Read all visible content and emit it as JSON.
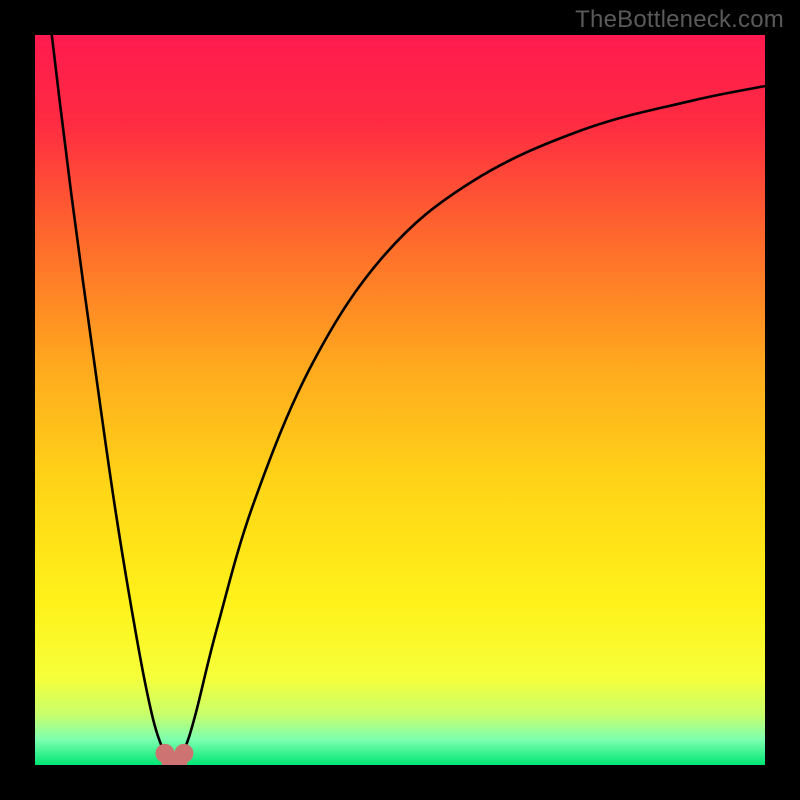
{
  "watermark": "TheBottleneck.com",
  "colors": {
    "frame": "#000000",
    "curve": "#000000",
    "marker": "#cd7472",
    "gradient_stops": [
      {
        "offset": 0.0,
        "color": "#ff1a4f"
      },
      {
        "offset": 0.12,
        "color": "#ff2b42"
      },
      {
        "offset": 0.28,
        "color": "#ff6a2c"
      },
      {
        "offset": 0.45,
        "color": "#ffa81e"
      },
      {
        "offset": 0.62,
        "color": "#ffd617"
      },
      {
        "offset": 0.78,
        "color": "#fff21a"
      },
      {
        "offset": 0.88,
        "color": "#f6ff3a"
      },
      {
        "offset": 0.93,
        "color": "#c9ff6a"
      },
      {
        "offset": 0.965,
        "color": "#7dffb0"
      },
      {
        "offset": 1.0,
        "color": "#00e673"
      }
    ]
  },
  "chart_data": {
    "type": "line",
    "title": "",
    "xlabel": "",
    "ylabel": "",
    "xlim": [
      0,
      100
    ],
    "ylim": [
      0,
      100
    ],
    "notes": "Single V-shaped bottleneck curve. x shown as position across plot width in %, y shown in % of plot height (0 = bottom/green, 100 = top/red). Minimum (optimal/no-bottleneck) near x≈19. Highlighted marker points along the floor of the V.",
    "series": [
      {
        "name": "bottleneck-curve",
        "x": [
          0,
          2.3,
          5,
          8,
          11,
          14,
          16,
          17.5,
          18.5,
          19,
          19.5,
          20.5,
          22,
          25,
          30,
          38,
          48,
          60,
          75,
          90,
          100
        ],
        "y": [
          120,
          100,
          78,
          56,
          35,
          17,
          7,
          2.2,
          0.6,
          0.3,
          0.6,
          2.2,
          7,
          19,
          36,
          55,
          70,
          80,
          87,
          91,
          93
        ]
      }
    ],
    "markers": {
      "name": "optimal-region-markers",
      "x": [
        17.8,
        18.6,
        19.6,
        20.4
      ],
      "y": [
        1.6,
        0.5,
        0.5,
        1.6
      ]
    }
  }
}
